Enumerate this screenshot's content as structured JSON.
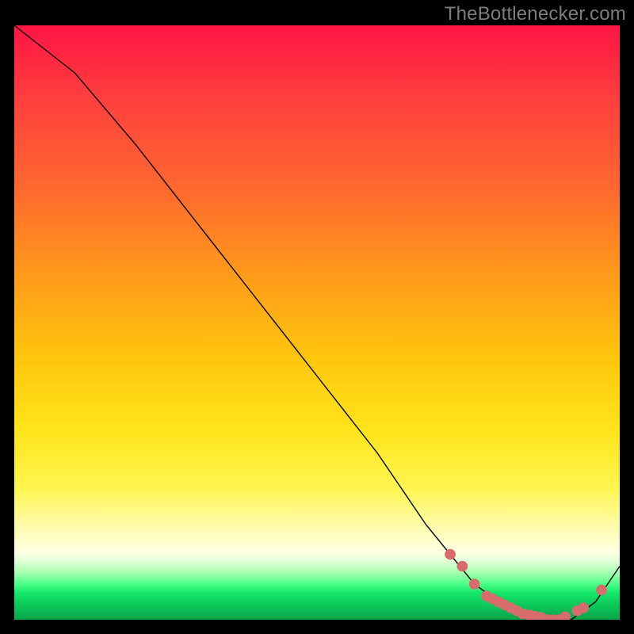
{
  "attribution": "TheBottlenecker.com",
  "chart_data": {
    "type": "line",
    "title": "",
    "xlabel": "",
    "ylabel": "",
    "xlim": [
      0,
      100
    ],
    "ylim": [
      0,
      100
    ],
    "series": [
      {
        "name": "curve",
        "x": [
          0,
          5,
          10,
          20,
          30,
          40,
          50,
          60,
          68,
          72,
          76,
          80,
          84,
          88,
          92,
          96,
          100
        ],
        "y": [
          100,
          96,
          92,
          80,
          67,
          54,
          41,
          28,
          16,
          11,
          6,
          3,
          1,
          0,
          0,
          3,
          9
        ]
      }
    ],
    "markers": {
      "name": "highlight-points",
      "color": "#d86b6b",
      "x": [
        72,
        74,
        76,
        78,
        79,
        80,
        81,
        82,
        83,
        84,
        85,
        86,
        87,
        88,
        89,
        90,
        91,
        93,
        94,
        97
      ],
      "y": [
        11,
        9,
        6,
        4,
        3.5,
        3,
        2.5,
        2,
        1.5,
        1,
        0.8,
        0.6,
        0.4,
        0,
        0,
        0,
        0.5,
        1.5,
        2,
        5
      ]
    }
  }
}
